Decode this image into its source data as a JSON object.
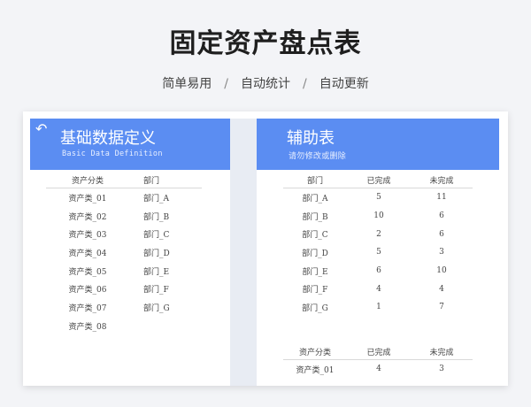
{
  "header": {
    "title": "固定资产盘点表",
    "features": [
      "简单易用",
      "自动统计",
      "自动更新"
    ],
    "separator": "/"
  },
  "left_panel": {
    "title": "基础数据定义",
    "subtitle": "Basic Data Definition",
    "back_icon": "undo-arrow-icon",
    "columns": [
      "资产分类",
      "部门"
    ],
    "rows": [
      [
        "资产类_01",
        "部门_A"
      ],
      [
        "资产类_02",
        "部门_B"
      ],
      [
        "资产类_03",
        "部门_C"
      ],
      [
        "资产类_04",
        "部门_D"
      ],
      [
        "资产类_05",
        "部门_E"
      ],
      [
        "资产类_06",
        "部门_F"
      ],
      [
        "资产类_07",
        "部门_G"
      ],
      [
        "资产类_08",
        ""
      ]
    ]
  },
  "right_panel": {
    "title": "辅助表",
    "subtitle": "请勿修改或删除",
    "dept_table": {
      "columns": [
        "部门",
        "已完成",
        "未完成"
      ],
      "rows": [
        [
          "部门_A",
          "5",
          "11"
        ],
        [
          "部门_B",
          "10",
          "6"
        ],
        [
          "部门_C",
          "2",
          "6"
        ],
        [
          "部门_D",
          "5",
          "3"
        ],
        [
          "部门_E",
          "6",
          "10"
        ],
        [
          "部门_F",
          "4",
          "4"
        ],
        [
          "部门_G",
          "1",
          "7"
        ]
      ]
    },
    "category_table": {
      "columns": [
        "资产分类",
        "已完成",
        "未完成"
      ],
      "rows": [
        [
          "资产类_01",
          "4",
          "3"
        ]
      ]
    }
  },
  "colors": {
    "banner": "#5b8df2",
    "background": "#f3f4f7"
  }
}
